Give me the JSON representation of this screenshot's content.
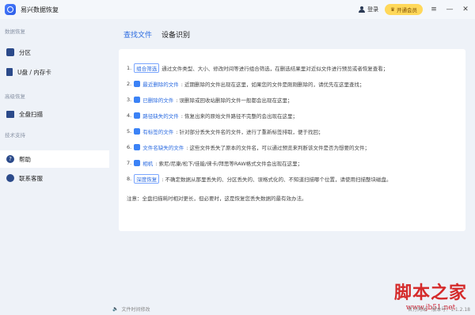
{
  "app": {
    "title": "易兴数据恢复"
  },
  "topbar": {
    "login": "登录",
    "vip": "开通会员"
  },
  "sidebar": {
    "sections": [
      {
        "label": "数据恢复",
        "items": [
          {
            "label": "分区"
          },
          {
            "label": "U盘 / 内存卡"
          }
        ]
      },
      {
        "label": "高级恢复",
        "items": [
          {
            "label": "全盘扫描"
          }
        ]
      },
      {
        "label": "技术支持",
        "items": [
          {
            "label": "帮助",
            "active": true
          },
          {
            "label": "联系客服"
          }
        ]
      }
    ]
  },
  "tabs": [
    {
      "label": "查找文件",
      "active": true
    },
    {
      "label": "设备识别"
    }
  ],
  "help": {
    "rows": [
      {
        "num": "1.",
        "tag": "组合筛选",
        "text": "通过文件类型、大小、修改时间等进行组合筛选，在删选结果里对近似文件进行预览或者恢复查看；"
      },
      {
        "num": "2.",
        "tag": "最近删除的文件",
        "text": ": 近期删除的文件出现在这里，如果您的文件是刚刚删除的，请优先在这里查找；"
      },
      {
        "num": "3.",
        "tag": "已删除的文件",
        "text": ": 误删除或回收站删除的文件一般都会出现在这里；"
      },
      {
        "num": "4.",
        "tag": "路径缺失的文件",
        "text": ": 恢复出来的原始文件路径不完整的会出现在这里；"
      },
      {
        "num": "5.",
        "tag": "有标签的文件",
        "text": ": 针对部分丢失文件名的文件，进行了重新标签排取，便于找回；"
      },
      {
        "num": "6.",
        "tag": "文件名缺失的文件",
        "text": ": 这些文件丢失了原本的文件名，可以通过预览来判断该文件是否为想要的文件；"
      },
      {
        "num": "7.",
        "tag": "相机",
        "text": ": 索尼/尼康/松下/佳能/徕卡/拜思等RAW格式文件会出现在这里；"
      },
      {
        "num": "8.",
        "tag": "深度恢复",
        "text": ": 不确定数据从那里丢失的、分区丢失的、误格式化的、不知道扫描哪个位置，请使用扫描整块磁盘。"
      }
    ],
    "note": "注意：全盘扫描耗时相对更长，但必要时，这是恢复您丢失数据的最有效办法。"
  },
  "footer": {
    "left": "文件时间修改",
    "site": "官方网站",
    "version": "版本号：1.1.2.18"
  },
  "watermark": {
    "title": "脚本之家",
    "url": "www.jb51.net"
  }
}
